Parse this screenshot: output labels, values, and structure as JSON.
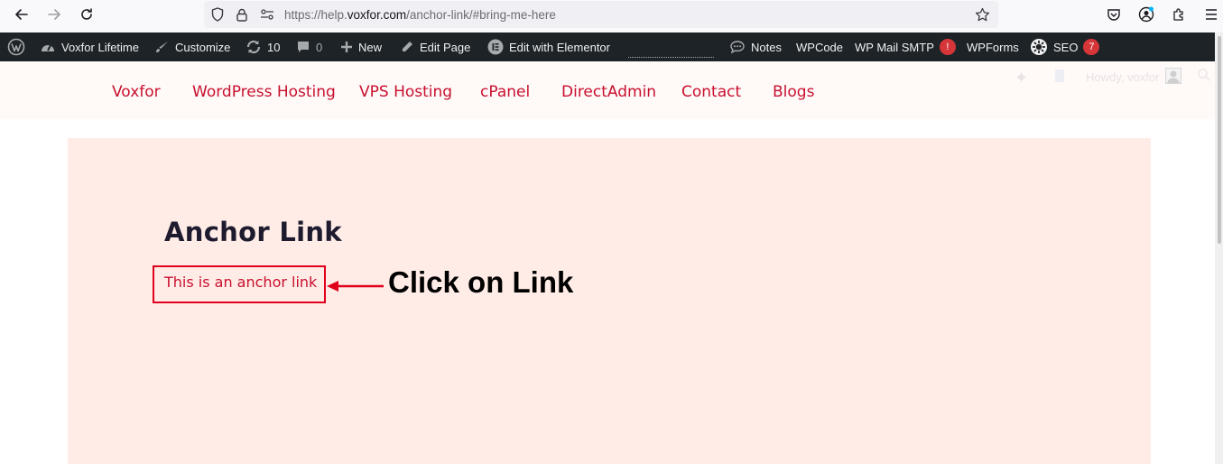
{
  "browser": {
    "url_prefix": "https://help.",
    "url_host": "voxfor.com",
    "url_path": "/anchor-link/#bring-me-here"
  },
  "adminbar": {
    "site_name": "Voxfor Lifetime",
    "customize": "Customize",
    "updates_count": "10",
    "comments_count": "0",
    "new_label": "New",
    "edit_page": "Edit Page",
    "edit_elementor": "Edit with Elementor",
    "notes": "Notes",
    "wpcode": "WPCode",
    "wp_mail_smtp": "WP Mail SMTP",
    "smtp_badge": "!",
    "wpforms": "WPForms",
    "seo": "SEO",
    "seo_badge": "7"
  },
  "header": {
    "menu": [
      "Voxfor",
      "WordPress Hosting",
      "VPS Hosting",
      "cPanel",
      "DirectAdmin",
      "Contact",
      "Blogs"
    ],
    "howdy": "Howdy, voxfor"
  },
  "content": {
    "heading": "Anchor Link",
    "link_text": "This is an anchor link",
    "annotation": "Click on Link"
  },
  "colors": {
    "accent": "#c8102e",
    "highlight_box": "#e0001b",
    "content_bg": "#ffece6",
    "adminbar_bg": "#1d2327"
  }
}
